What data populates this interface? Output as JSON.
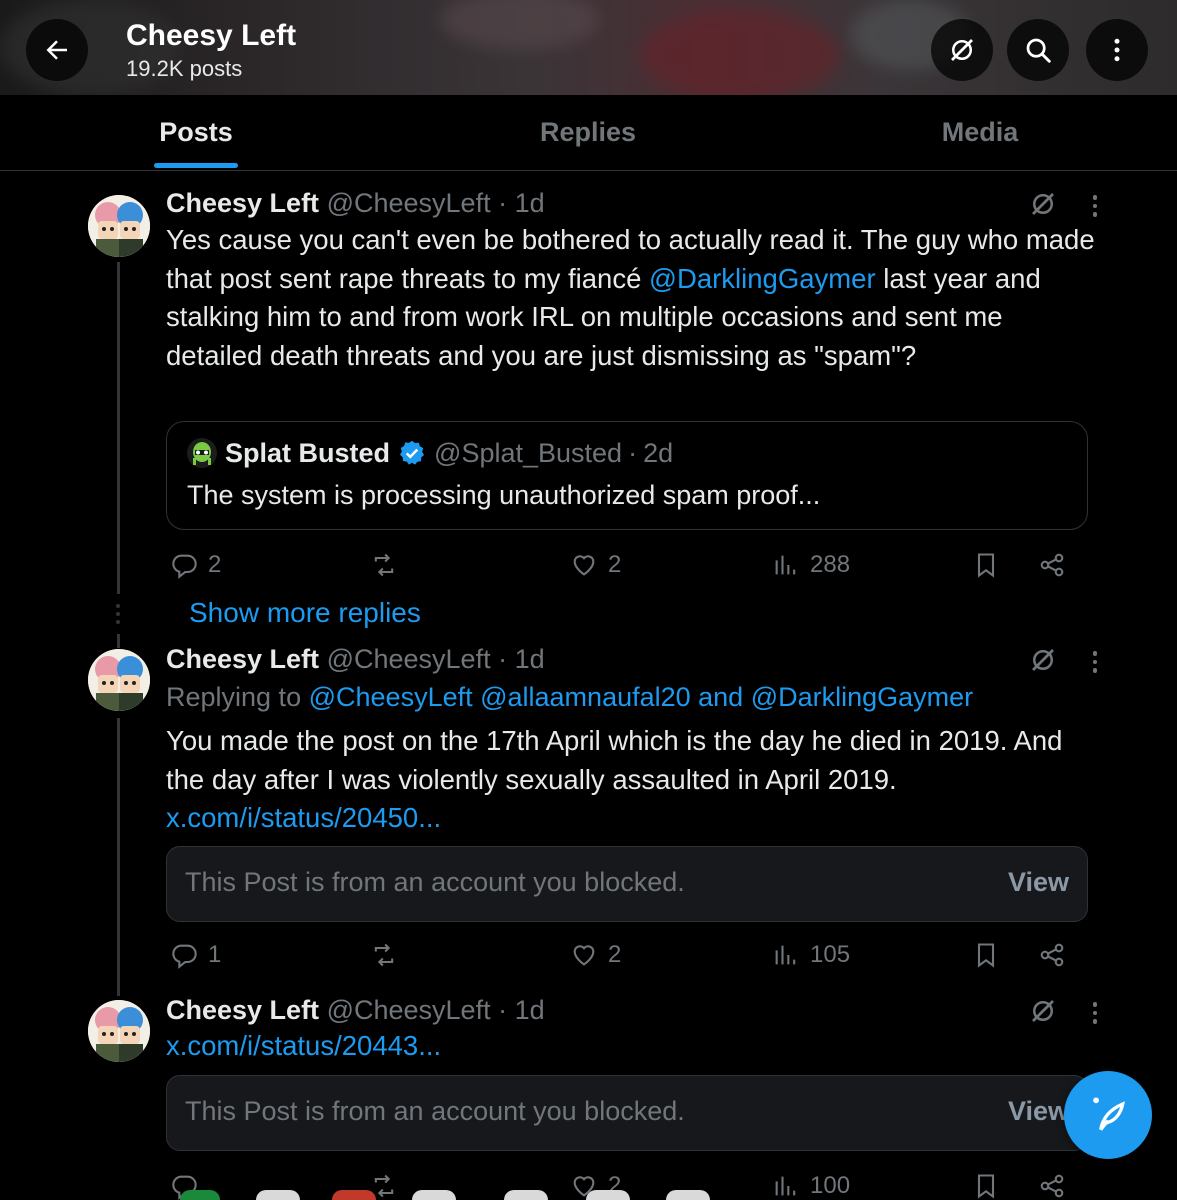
{
  "header": {
    "title": "Cheesy Left",
    "post_count": "19.2K posts",
    "back_icon": "arrow-left-icon",
    "grok_icon": "grok-icon",
    "search_icon": "search-icon",
    "more_icon": "more-vertical-icon"
  },
  "tabs": [
    {
      "label": "Posts",
      "active": true
    },
    {
      "label": "Replies",
      "active": false
    },
    {
      "label": "Media",
      "active": false
    }
  ],
  "posts": [
    {
      "name": "Cheesy Left",
      "handle": "@CheesyLeft",
      "time": "1d",
      "text_parts": [
        "Yes cause you can't even be bothered to actually read it. The guy who made that post sent rape threats to my fiancé ",
        "@DarklingGaymer",
        " last year and stalking him to and from work IRL on multiple occasions and sent me detailed death threats and you are just dismissing as \"spam\"?"
      ],
      "quote": {
        "name": "Splat Busted",
        "handle": "@Splat_Busted",
        "time": "2d",
        "text": "The system is processing unauthorized spam proof..."
      },
      "actions": {
        "replies": "2",
        "reposts": "",
        "likes": "2",
        "views": "288"
      }
    },
    {
      "name": "Cheesy Left",
      "handle": "@CheesyLeft",
      "time": "1d",
      "replying_label": "Replying to",
      "replying_to": "@CheesyLeft @allaamnaufal20 and @DarklingGaymer",
      "text": "You made the post on the 17th April which is the day he died in 2019. And the day after I was violently sexually assaulted in April 2019.",
      "link": "x.com/i/status/20450...",
      "blocked_text": "This Post is from an account you blocked.",
      "blocked_action": "View",
      "actions": {
        "replies": "1",
        "reposts": "",
        "likes": "2",
        "views": "105"
      }
    },
    {
      "name": "Cheesy Left",
      "handle": "@CheesyLeft",
      "time": "1d",
      "link": "x.com/i/status/20443...",
      "blocked_text": "This Post is from an account you blocked.",
      "blocked_action": "View",
      "actions": {
        "replies": "",
        "reposts": "",
        "likes": "2",
        "views": "100"
      }
    }
  ],
  "show_more_replies": "Show more replies",
  "fab_icon": "compose-post-icon",
  "colors": {
    "accent": "#1d9bf0",
    "muted": "#71767b",
    "bg": "#000000",
    "text": "#e7e9ea"
  }
}
